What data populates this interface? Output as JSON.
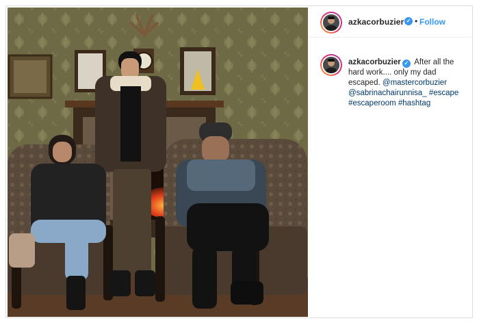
{
  "post": {
    "username": "azkacorbuzier",
    "follow_label": "Follow",
    "separator": "•"
  },
  "caption": {
    "username": "azkacorbuzier",
    "text": "After all the hard work.... only my dad escaped.",
    "mention_1": "@mastercorbuzier",
    "mention_2": "@sabrinachairunnisa_",
    "hashtag_1": "#escape",
    "hashtag_2": "#escaperoom",
    "hashtag_3": "#hashtag"
  },
  "icons": {
    "verified": "verified-badge-icon",
    "check_glyph": "✓"
  },
  "colors": {
    "accent": "#3897f0",
    "link": "#00376b",
    "text": "#262626",
    "border": "#dbdbdb"
  }
}
